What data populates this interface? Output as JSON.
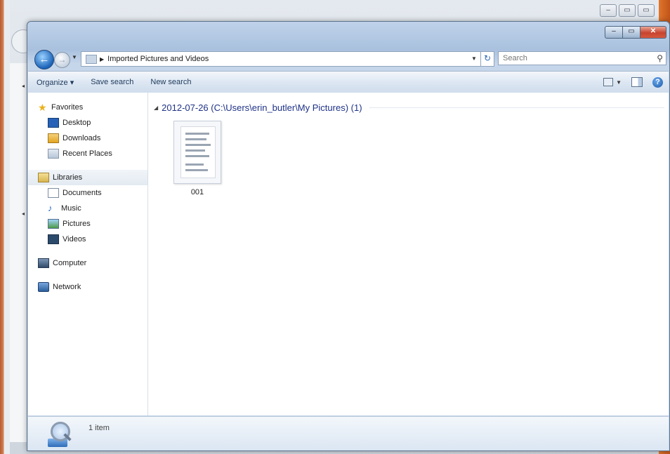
{
  "window": {
    "caption_buttons": {
      "minimize": "–",
      "maximize": "▭",
      "close": "✕"
    }
  },
  "address_bar": {
    "path": "Imported Pictures and Videos",
    "search_placeholder": "Search"
  },
  "command_bar": {
    "organize": "Organize ▾",
    "save_search": "Save search",
    "new_search": "New search"
  },
  "nav": {
    "favorites": "Favorites",
    "desktop": "Desktop",
    "downloads": "Downloads",
    "recent_places": "Recent Places",
    "libraries": "Libraries",
    "documents": "Documents",
    "music": "Music",
    "pictures": "Pictures",
    "videos": "Videos",
    "computer": "Computer",
    "network": "Network"
  },
  "content": {
    "group_header": "2012-07-26 (C:\\Users\\erin_butler\\My Pictures) (1)",
    "files": [
      {
        "name": "001"
      }
    ]
  },
  "details": {
    "item_count": "1 item"
  },
  "icons": {
    "back": "back-arrow-icon",
    "forward": "forward-arrow-icon",
    "search": "search-icon",
    "help": "help-icon",
    "refresh": "refresh-icon"
  }
}
